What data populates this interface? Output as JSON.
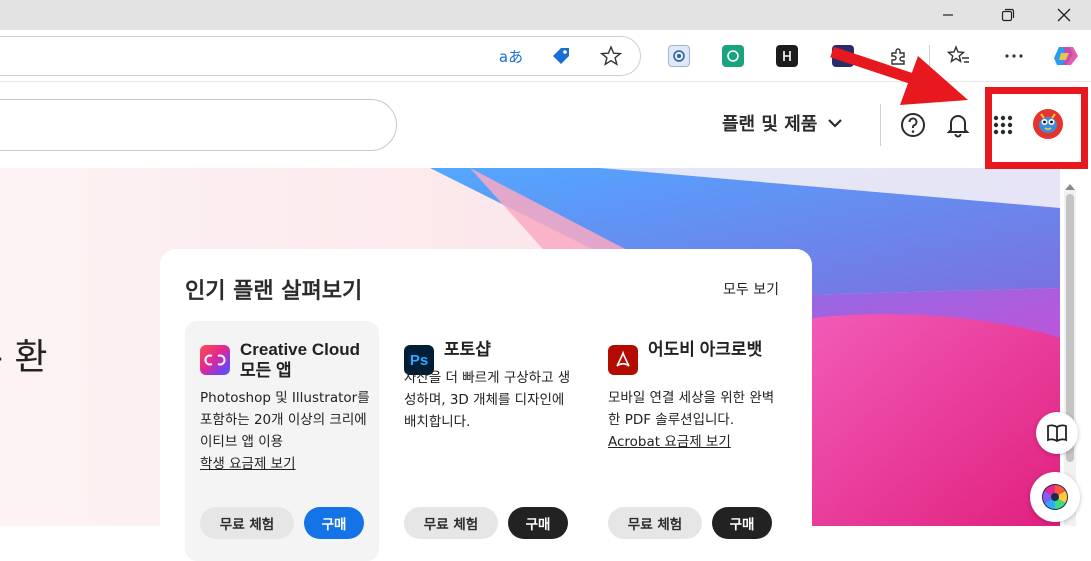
{
  "browser": {
    "toolbar_extensions": [
      {
        "name": "read-aloud-icon",
        "glyph": "aあ"
      },
      {
        "name": "tag-icon"
      },
      {
        "name": "favorite-star-icon"
      },
      {
        "name": "extension-blue-icon"
      },
      {
        "name": "chatgpt-icon"
      },
      {
        "name": "extension-dark-icon"
      },
      {
        "name": "extension-avatar-icon"
      },
      {
        "name": "puzzle-icon"
      },
      {
        "name": "favorites-icon"
      },
      {
        "name": "more-icon"
      },
      {
        "name": "copilot-icon"
      }
    ]
  },
  "header": {
    "plans_label": "플랜 및 제품"
  },
  "hero": {
    "text": "- 환"
  },
  "card": {
    "title": "인기 플랜 살펴보기",
    "see_all": "모두 보기",
    "plans": [
      {
        "name": "Creative Cloud 모든 앱",
        "logo": "Cc",
        "description": "Photoshop 및 Illustrator를 포함하는 20개 이상의 크리에이티브 앱 이용",
        "link": "학생 요금제 보기",
        "trial_label": "무료 체험",
        "buy_label": "구매"
      },
      {
        "name": "포토샵",
        "logo": "Ps",
        "description": "자산을 더 빠르게 구상하고 생성하며, 3D 개체를 디자인에 배치합니다.",
        "link": "",
        "trial_label": "무료 체험",
        "buy_label": "구매"
      },
      {
        "name": "어도비 아크로뱃",
        "logo": "A",
        "description": "모바일 연결 세상을 위한 완벽한 PDF 솔루션입니다.",
        "link": "Acrobat 요금제 보기",
        "trial_label": "무료 체험",
        "buy_label": "구매"
      }
    ]
  },
  "colors": {
    "annotation_red": "#e8191e",
    "adobe_blue": "#1473e6",
    "ps_bg": "#001e36",
    "acrobat_red": "#b30b00"
  }
}
